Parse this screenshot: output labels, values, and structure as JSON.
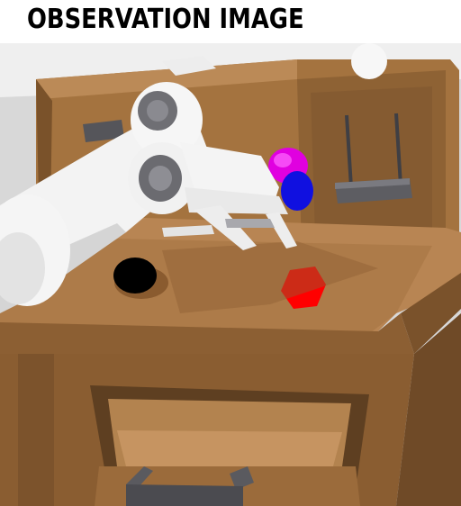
{
  "header": {
    "title": "OBSERVATION IMAGE"
  },
  "scene": {
    "objects": [
      "robot-arm",
      "gripper",
      "wooden-table",
      "open-drawer",
      "drawer-handle",
      "black-puck",
      "red-block",
      "magenta-object",
      "blue-object",
      "wall-rack",
      "hook-rack-handle",
      "white-sphere",
      "white-lid"
    ],
    "colors": {
      "wood_light": "#b38151",
      "wood_mid": "#9a6c3f",
      "wood_dark": "#6e4a28",
      "robot_white": "#f2f2f2",
      "robot_gray": "#6f6f74",
      "red_block": "#ff0000",
      "magenta": "#e000e0",
      "blue": "#1010e0",
      "puck": "#000000",
      "background": "#dcdcdc"
    }
  }
}
